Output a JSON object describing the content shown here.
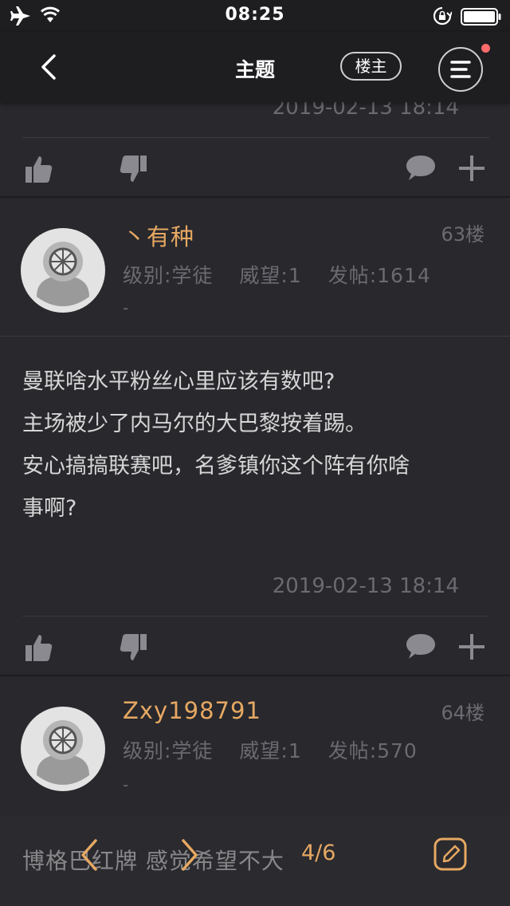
{
  "status_bar": {
    "time": "08:25"
  },
  "nav": {
    "title": "主题",
    "owner_filter": "楼主"
  },
  "previous_post": {
    "timestamp": "2019-02-13 18:14"
  },
  "posts": [
    {
      "username": "丶有种",
      "floor": "63楼",
      "level": "级别:学徒",
      "reputation": "威望:1",
      "post_count": "发帖:1614",
      "signature": "-",
      "content_lines": [
        "曼联啥水平粉丝心里应该有数吧?",
        "主场被少了内马尔的大巴黎按着踢。",
        "安心搞搞联赛吧，名爹镇你这个阵有你啥",
        "事啊?"
      ],
      "timestamp": "2019-02-13 18:14"
    },
    {
      "username": "Zxy198791",
      "floor": "64楼",
      "level": "级别:学徒",
      "reputation": "威望:1",
      "post_count": "发帖:570",
      "signature": "-"
    }
  ],
  "bottom_bar": {
    "behind_text": "博格巴红牌 感觉希望不大",
    "page": "4/6"
  },
  "colors": {
    "background": "#28282d",
    "header": "#1e1e21",
    "accent": "#e6a862",
    "muted": "#6a6a70",
    "notification_dot": "#ff6b6b"
  },
  "icons": [
    "airplane-icon",
    "wifi-icon",
    "rotation-lock-icon",
    "battery-icon",
    "back-chevron-icon",
    "menu-icon",
    "thumbs-up-icon",
    "thumbs-down-icon",
    "comment-icon",
    "plus-icon",
    "prev-page-icon",
    "next-page-icon",
    "edit-icon"
  ]
}
